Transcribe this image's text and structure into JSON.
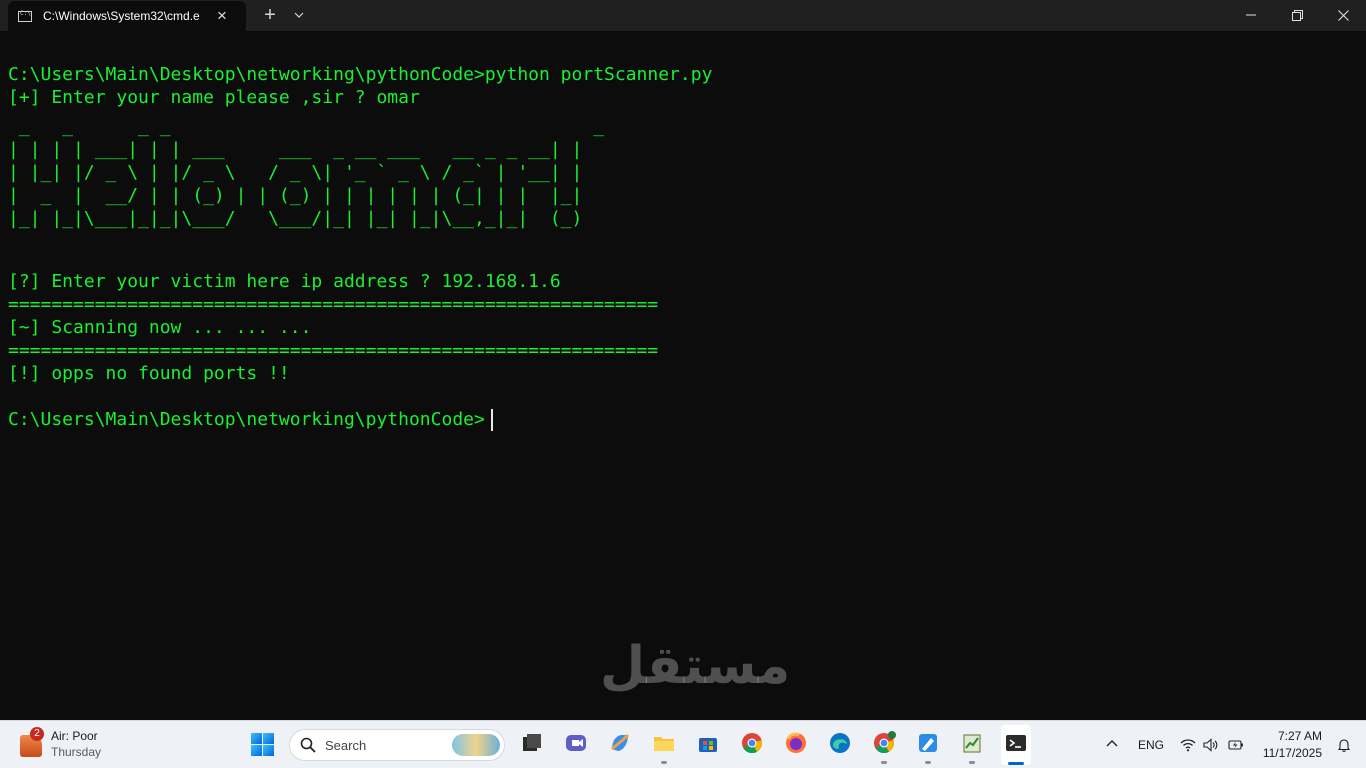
{
  "window": {
    "tab_title": "C:\\Windows\\System32\\cmd.e",
    "new_tab_glyph": "+",
    "dropdown_icon": "chevron-down-icon",
    "close_glyph": "×"
  },
  "terminal": {
    "foreground": "#18f031",
    "lines": [
      "C:\\Users\\Main\\Desktop\\networking\\pythonCode>python portScanner.py",
      "[+] Enter your name please ,sir ? omar",
      "[?] Enter your victim here ip address ? 192.168.1.6",
      "============================================================",
      "[~] Scanning now ... ... ...",
      "============================================================",
      "[!] opps no found ports !!",
      "C:\\Users\\Main\\Desktop\\networking\\pythonCode>"
    ],
    "ascii_banner": " _   _      _ _                                       _ \n| | | | ___| | | ___     ___  _ __ ___   __ _ _ __| |\n| |_| |/ _ \\ | |/ _ \\   / _ \\| '_ ` _ \\ / _` | '__| |\n|  _  |  __/ | | (_) | | (_) | | | | | | (_| | |  |_|\n|_| |_|\\___|_|_|\\___/   \\___/|_| |_| |_|\\__,_|_|  (_)"
  },
  "watermark": "مستقل",
  "taskbar": {
    "weather": {
      "badge": "2",
      "title": "Air: Poor",
      "day": "Thursday"
    },
    "search_placeholder": "Search",
    "language": "ENG",
    "time": "7:27 AM",
    "date": "11/17/2025"
  }
}
